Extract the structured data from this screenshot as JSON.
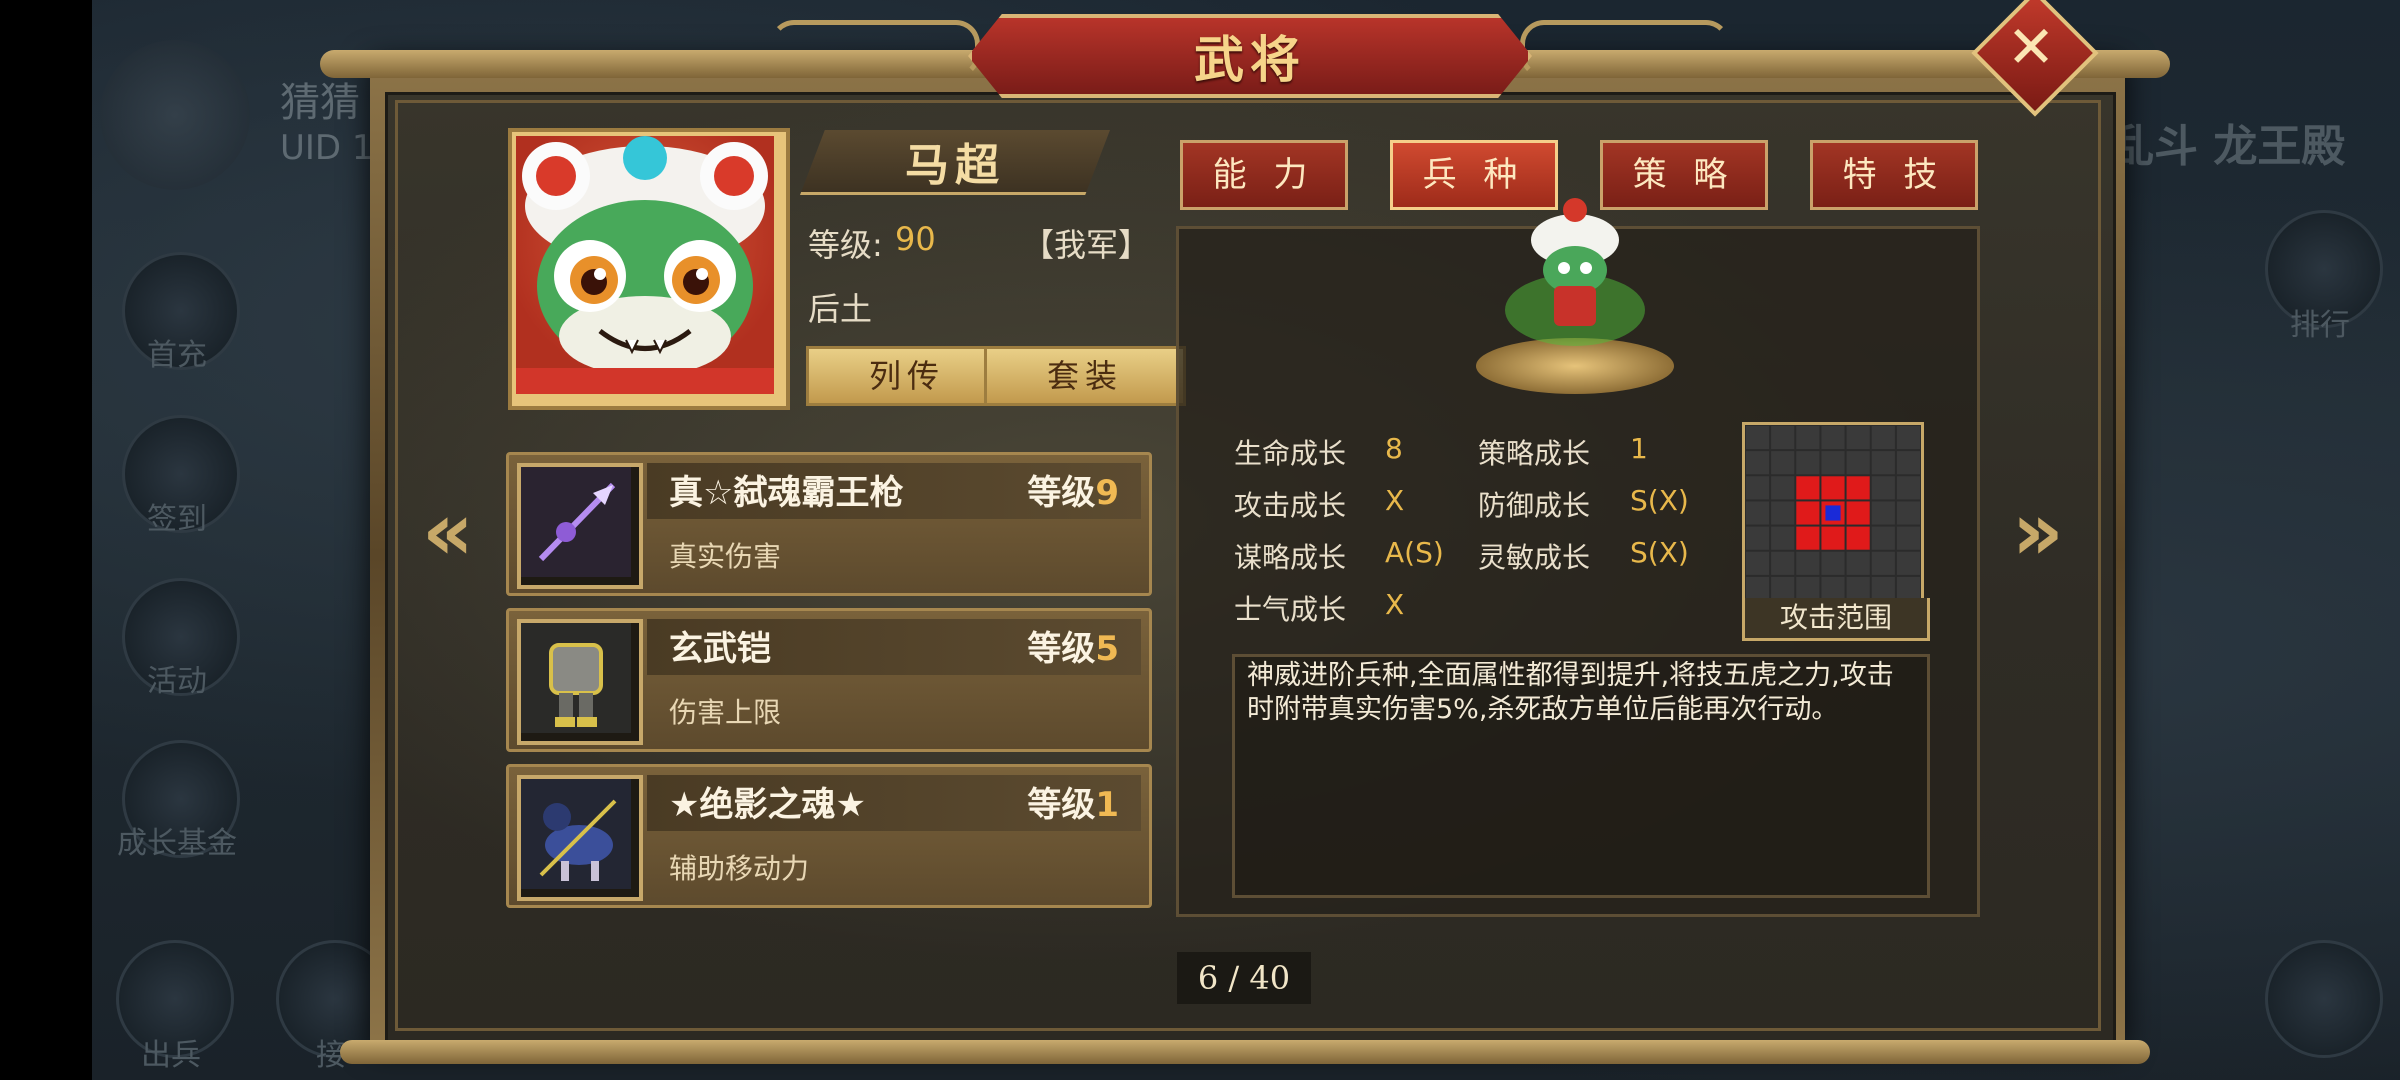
{
  "background": {
    "nickname": "猜猜",
    "uid": "UID 1",
    "right_title": "乱斗 龙王殿",
    "side_menu": [
      "首充",
      "签到",
      "活动",
      "成长基金",
      "出兵",
      "接"
    ],
    "right_menu": [
      "排行"
    ]
  },
  "dialog": {
    "title": "武将"
  },
  "general": {
    "name": "马超",
    "level_label": "等级:",
    "level_value": "90",
    "faction": "【我军】",
    "title": "后土",
    "buttons": {
      "biography": "列传",
      "set": "套装"
    }
  },
  "equipment": [
    {
      "name": "真☆弑魂霸王枪",
      "level_label": "等级",
      "level": "9",
      "desc": "真实伤害",
      "icon": "spear-icon"
    },
    {
      "name": "玄武铠",
      "level_label": "等级",
      "level": "5",
      "desc": "伤害上限",
      "icon": "armor-icon"
    },
    {
      "name": "★绝影之魂★",
      "level_label": "等级",
      "level": "1",
      "desc": "辅助移动力",
      "icon": "mount-icon"
    }
  ],
  "tabs": [
    {
      "label": "能 力",
      "active": false
    },
    {
      "label": "兵 种",
      "active": true
    },
    {
      "label": "策 略",
      "active": false
    },
    {
      "label": "特 技",
      "active": false
    }
  ],
  "stats": {
    "hp_growth": {
      "label": "生命成长",
      "value": "8"
    },
    "strategy_growth": {
      "label": "策略成长",
      "value": "1"
    },
    "attack_growth": {
      "label": "攻击成长",
      "value": "X"
    },
    "defense_growth": {
      "label": "防御成长",
      "value": "S(X)"
    },
    "intellect_growth": {
      "label": "谋略成长",
      "value": "A(S)"
    },
    "agility_growth": {
      "label": "灵敏成长",
      "value": "S(X)"
    },
    "morale_growth": {
      "label": "士气成长",
      "value": "X"
    }
  },
  "attack_range": {
    "label": "攻击范围",
    "cell_color": "#e01a1a",
    "center_color": "#1a2ad8"
  },
  "description": "神威进阶兵种,全面属性都得到提升,将技五虎之力,攻击时附带真实伤害5%,杀死敌方单位后能再次行动。",
  "pagination": {
    "text": "6 / 40"
  },
  "colors": {
    "gold": "#e8b84b",
    "tab_red": "#a23524",
    "frame": "#8d7448"
  }
}
